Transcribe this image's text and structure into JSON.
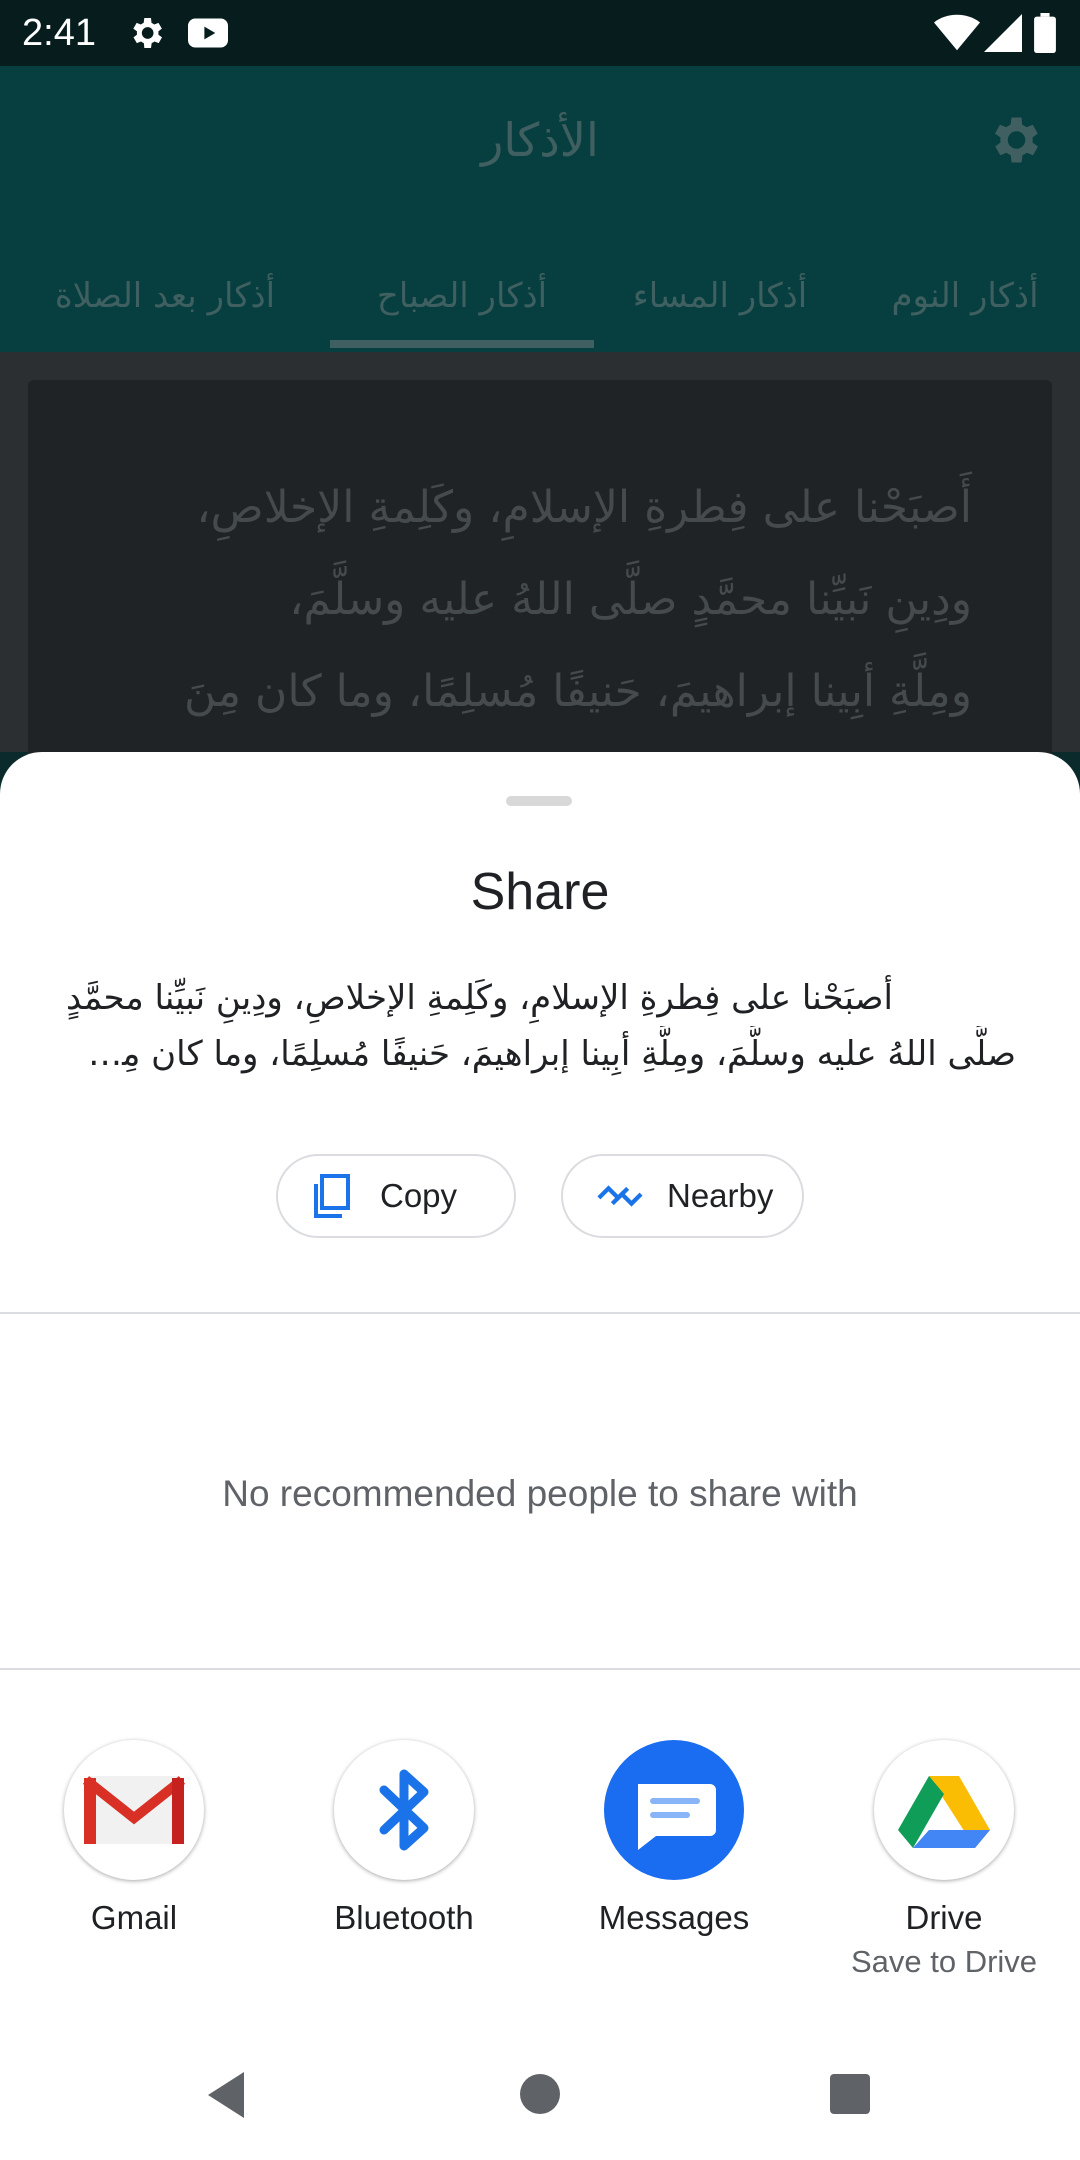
{
  "status_bar": {
    "time": "2:41"
  },
  "app_bar": {
    "title": "الأذكار",
    "tabs": [
      {
        "label": "أذكار النوم"
      },
      {
        "label": "أذكار المساء"
      },
      {
        "label": "أذكار الصباح",
        "selected": true
      },
      {
        "label": "أذكار بعد الصلاة"
      }
    ]
  },
  "card": {
    "lines": [
      "أَصبَحْنا على فِطرةِ الإسلامِ، وكَلِمةِ الإخلاصِ،",
      "ودِينِ نَبيِّنا محمَّدٍ صلَّى اللهُ عليه وسلَّمَ،",
      "ومِلَّةِ أبِينا إبراهيمَ، حَنيفًا مُسلِمًا، وما كان مِنَ"
    ]
  },
  "share_sheet": {
    "title": "Share",
    "preview_lines": [
      "أصبَحْنا على فِطرةِ الإسلامِ، وكَلِمةِ الإخلاصِ، ودِينِ نَبيِّنا محمَّدٍ",
      "صلَّى اللهُ عليه وسلَّمَ، ومِلَّةِ أبِينا إبراهيمَ، حَنيفًا مُسلِمًا، وما كان مِنَ ال..."
    ],
    "copy_label": "Copy",
    "nearby_label": "Nearby",
    "empty_people": "No recommended people to share with",
    "apps": [
      {
        "name": "Gmail",
        "subtitle": ""
      },
      {
        "name": "Bluetooth",
        "subtitle": ""
      },
      {
        "name": "Messages",
        "subtitle": ""
      },
      {
        "name": "Drive",
        "subtitle": "Save to Drive"
      }
    ]
  },
  "colors": {
    "app_bar": "#073f40",
    "status_bar": "#071c1d",
    "accent_blue": "#1a73e8",
    "messages_blue": "#1a6cf0"
  },
  "icons": {
    "status": [
      "settings-icon",
      "youtube-icon",
      "wifi-icon",
      "signal-icon",
      "battery-icon"
    ],
    "nav": [
      "back-icon",
      "home-icon",
      "recents-icon"
    ]
  }
}
